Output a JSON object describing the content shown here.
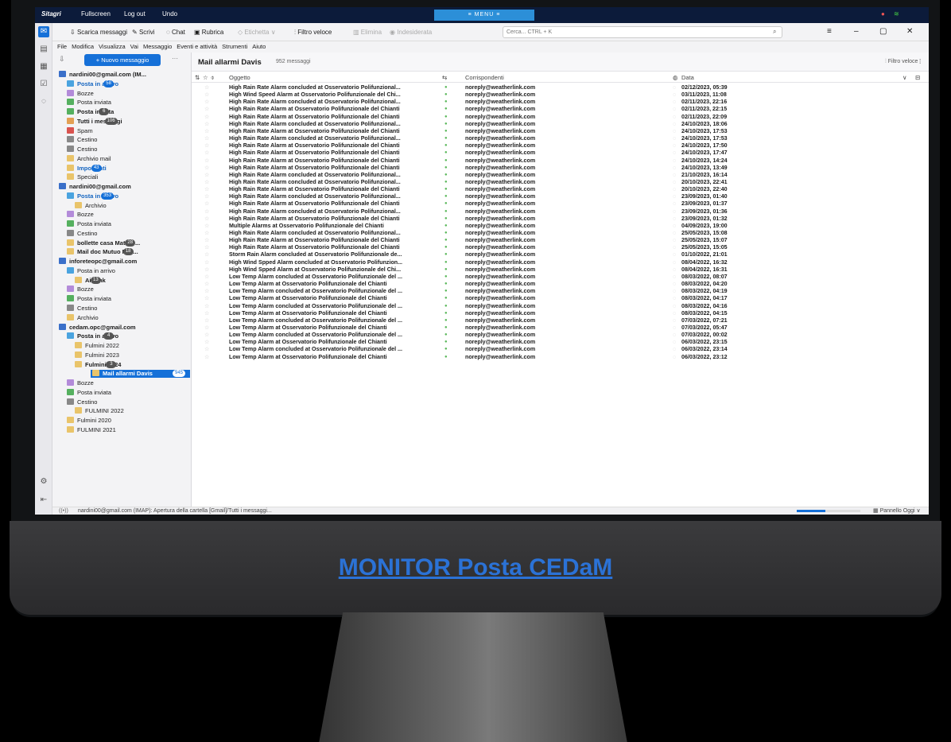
{
  "topbar": {
    "brand": "Sitagri",
    "fullscreen": "Fullscreen",
    "logout": "Log out",
    "undo": "Undo",
    "menu": "≡ MENU ≡"
  },
  "toolbar": {
    "get_messages": "Scarica messaggi",
    "write": "Scrivi",
    "chat": "Chat",
    "address_book": "Rubrica",
    "tag": "Etichetta",
    "quick_filter": "Filtro veloce",
    "delete": "Elimina",
    "junk": "Indesiderata",
    "search_placeholder": "Cerca... CTRL + K"
  },
  "menubar": [
    "File",
    "Modifica",
    "Visualizza",
    "Vai",
    "Messaggio",
    "Eventi e attività",
    "Strumenti",
    "Aiuto"
  ],
  "new_message": "+ Nuovo messaggio",
  "folders": [
    {
      "label": "nardini00@gmail.com (IM...",
      "bold": true,
      "account": true,
      "color": "#3a6fc9",
      "indent": 0
    },
    {
      "label": "Posta in arrivo",
      "bold": true,
      "badge": "58",
      "color": "#4aa3df",
      "indent": 1,
      "blue": true
    },
    {
      "label": "Bozze",
      "color": "#b38bd9",
      "indent": 1
    },
    {
      "label": "Posta inviata",
      "color": "#55b05f",
      "indent": 1
    },
    {
      "label": "Posta inviata",
      "bold": true,
      "badge": "6",
      "color": "#55b05f",
      "indent": 1
    },
    {
      "label": "Tutti i messaggi",
      "bold": true,
      "badge": "106",
      "color": "#e3a054",
      "indent": 1
    },
    {
      "label": "Spam",
      "color": "#d9534f",
      "indent": 1
    },
    {
      "label": "Cestino",
      "color": "#888",
      "indent": 1
    },
    {
      "label": "Cestino",
      "color": "#888",
      "indent": 1
    },
    {
      "label": "Archivio mail",
      "color": "#e9c46a",
      "indent": 1
    },
    {
      "label": "Importanti",
      "bold": true,
      "badge": "43",
      "color": "#e9c46a",
      "indent": 1,
      "blue": true
    },
    {
      "label": "Speciali",
      "color": "#e9c46a",
      "indent": 1
    },
    {
      "label": "nardini00@gmail.com",
      "bold": true,
      "account": true,
      "color": "#3a6fc9",
      "indent": 0
    },
    {
      "label": "Posta in arrivo",
      "bold": true,
      "badge": "353",
      "color": "#4aa3df",
      "indent": 1,
      "blue": true
    },
    {
      "label": "Archivio",
      "color": "#e9c46a",
      "indent": 2
    },
    {
      "label": "Bozze",
      "color": "#b38bd9",
      "indent": 1
    },
    {
      "label": "Posta inviata",
      "color": "#55b05f",
      "indent": 1
    },
    {
      "label": "Cestino",
      "color": "#888",
      "indent": 1
    },
    {
      "label": "bollette casa Matass...",
      "bold": true,
      "badge": "28",
      "color": "#e9c46a",
      "indent": 1
    },
    {
      "label": "Mail doc Mutuo Pite...",
      "bold": true,
      "badge": "18",
      "color": "#e9c46a",
      "indent": 1
    },
    {
      "label": "inforeteopc@gmail.com",
      "bold": true,
      "account": true,
      "color": "#3a6fc9",
      "indent": 0
    },
    {
      "label": "Posta in arrivo",
      "color": "#4aa3df",
      "indent": 1
    },
    {
      "label": "AirLink",
      "bold": true,
      "badge": "13",
      "color": "#e9c46a",
      "indent": 2
    },
    {
      "label": "Bozze",
      "color": "#b38bd9",
      "indent": 1
    },
    {
      "label": "Posta inviata",
      "color": "#55b05f",
      "indent": 1
    },
    {
      "label": "Cestino",
      "color": "#888",
      "indent": 1
    },
    {
      "label": "Archivio",
      "color": "#e9c46a",
      "indent": 1
    },
    {
      "label": "cedam.opc@gmail.com",
      "bold": true,
      "account": true,
      "color": "#3a6fc9",
      "indent": 0
    },
    {
      "label": "Posta in arrivo",
      "bold": true,
      "badge": "4",
      "color": "#4aa3df",
      "indent": 1
    },
    {
      "label": "Fulmini 2022",
      "color": "#e9c46a",
      "indent": 2
    },
    {
      "label": "Fulmini 2023",
      "color": "#e9c46a",
      "indent": 2
    },
    {
      "label": "Fulmini 2024",
      "bold": true,
      "badge": "3",
      "color": "#e9c46a",
      "indent": 2
    },
    {
      "label": "Mail allarmi Davis",
      "bold": true,
      "badge": "945",
      "color": "#e9c46a",
      "indent": 2,
      "selected": true
    },
    {
      "label": "Bozze",
      "color": "#b38bd9",
      "indent": 1
    },
    {
      "label": "Posta inviata",
      "color": "#55b05f",
      "indent": 1
    },
    {
      "label": "Cestino",
      "color": "#888",
      "indent": 1
    },
    {
      "label": "FULMINI 2022",
      "color": "#e9c46a",
      "indent": 2
    },
    {
      "label": "Fulmini 2020",
      "color": "#e9c46a",
      "indent": 1
    },
    {
      "label": "FULMINI 2021",
      "color": "#e9c46a",
      "indent": 1
    }
  ],
  "list": {
    "title": "Mail allarmi Davis",
    "count": "952 messaggi",
    "quick_filter": "Filtro veloce"
  },
  "columns": {
    "subject": "Oggetto",
    "correspondents": "Corrispondenti",
    "date": "Data"
  },
  "messages": [
    [
      "High Rain Rate Alarm concluded at Osservatorio Polifunzional...",
      "noreply@weatherlink.com",
      "02/12/2023, 05:39"
    ],
    [
      "High Wind Speed Alarm at Osservatorio Polifunzionale del Chi...",
      "noreply@weatherlink.com",
      "03/11/2023, 11:08"
    ],
    [
      "High Rain Rate Alarm concluded at Osservatorio Polifunzional...",
      "noreply@weatherlink.com",
      "02/11/2023, 22:16"
    ],
    [
      "High Rain Rate Alarm at Osservatorio Polifunzionale del Chianti",
      "noreply@weatherlink.com",
      "02/11/2023, 22:15"
    ],
    [
      "High Rain Rate Alarm at Osservatorio Polifunzionale del Chianti",
      "noreply@weatherlink.com",
      "02/11/2023, 22:09"
    ],
    [
      "High Rain Rate Alarm concluded at Osservatorio Polifunzional...",
      "noreply@weatherlink.com",
      "24/10/2023, 18:06"
    ],
    [
      "High Rain Rate Alarm at Osservatorio Polifunzionale del Chianti",
      "noreply@weatherlink.com",
      "24/10/2023, 17:53"
    ],
    [
      "High Rain Rate Alarm concluded at Osservatorio Polifunzional...",
      "noreply@weatherlink.com",
      "24/10/2023, 17:53"
    ],
    [
      "High Rain Rate Alarm at Osservatorio Polifunzionale del Chianti",
      "noreply@weatherlink.com",
      "24/10/2023, 17:50"
    ],
    [
      "High Rain Rate Alarm at Osservatorio Polifunzionale del Chianti",
      "noreply@weatherlink.com",
      "24/10/2023, 17:47"
    ],
    [
      "High Rain Rate Alarm at Osservatorio Polifunzionale del Chianti",
      "noreply@weatherlink.com",
      "24/10/2023, 14:24"
    ],
    [
      "High Rain Rate Alarm at Osservatorio Polifunzionale del Chianti",
      "noreply@weatherlink.com",
      "24/10/2023, 13:49"
    ],
    [
      "High Rain Rate Alarm concluded at Osservatorio Polifunzional...",
      "noreply@weatherlink.com",
      "21/10/2023, 16:14"
    ],
    [
      "High Rain Rate Alarm concluded at Osservatorio Polifunzional...",
      "noreply@weatherlink.com",
      "20/10/2023, 22:41"
    ],
    [
      "High Rain Rate Alarm at Osservatorio Polifunzionale del Chianti",
      "noreply@weatherlink.com",
      "20/10/2023, 22:40"
    ],
    [
      "High Rain Rate Alarm concluded at Osservatorio Polifunzional...",
      "noreply@weatherlink.com",
      "23/09/2023, 01:40"
    ],
    [
      "High Rain Rate Alarm at Osservatorio Polifunzionale del Chianti",
      "noreply@weatherlink.com",
      "23/09/2023, 01:37"
    ],
    [
      "High Rain Rate Alarm concluded at Osservatorio Polifunzional...",
      "noreply@weatherlink.com",
      "23/09/2023, 01:36"
    ],
    [
      "High Rain Rate Alarm at Osservatorio Polifunzionale del Chianti",
      "noreply@weatherlink.com",
      "23/09/2023, 01:32"
    ],
    [
      "Multiple Alarms at Osservatorio Polifunzionale del Chianti",
      "noreply@weatherlink.com",
      "04/09/2023, 19:00"
    ],
    [
      "High Rain Rate Alarm concluded at Osservatorio Polifunzional...",
      "noreply@weatherlink.com",
      "25/05/2023, 15:08"
    ],
    [
      "High Rain Rate Alarm at Osservatorio Polifunzionale del Chianti",
      "noreply@weatherlink.com",
      "25/05/2023, 15:07"
    ],
    [
      "High Rain Rate Alarm at Osservatorio Polifunzionale del Chianti",
      "noreply@weatherlink.com",
      "25/05/2023, 15:05"
    ],
    [
      "Storm Rain Alarm concluded at Osservatorio Polifunzionale de...",
      "noreply@weatherlink.com",
      "01/10/2022, 21:01"
    ],
    [
      "High Wind Spped Alarm concluded at Osservatorio Polifunzion...",
      "noreply@weatherlink.com",
      "08/04/2022, 16:32"
    ],
    [
      "High Wind Spped Alarm at Osservatorio Polifunzionale del Chi...",
      "noreply@weatherlink.com",
      "08/04/2022, 16:31"
    ],
    [
      "Low Temp Alarm concluded at Osservatorio Polifunzionale del ...",
      "noreply@weatherlink.com",
      "08/03/2022, 08:07"
    ],
    [
      "Low Temp Alarm at Osservatorio Polifunzionale del Chianti",
      "noreply@weatherlink.com",
      "08/03/2022, 04:20"
    ],
    [
      "Low Temp Alarm concluded at Osservatorio Polifunzionale del ...",
      "noreply@weatherlink.com",
      "08/03/2022, 04:19"
    ],
    [
      "Low Temp Alarm at Osservatorio Polifunzionale del Chianti",
      "noreply@weatherlink.com",
      "08/03/2022, 04:17"
    ],
    [
      "Low Temp Alarm concluded at Osservatorio Polifunzionale del ...",
      "noreply@weatherlink.com",
      "08/03/2022, 04:16"
    ],
    [
      "Low Temp Alarm at Osservatorio Polifunzionale del Chianti",
      "noreply@weatherlink.com",
      "08/03/2022, 04:15"
    ],
    [
      "Low Temp Alarm concluded at Osservatorio Polifunzionale del ...",
      "noreply@weatherlink.com",
      "07/03/2022, 07:21"
    ],
    [
      "Low Temp Alarm at Osservatorio Polifunzionale del Chianti",
      "noreply@weatherlink.com",
      "07/03/2022, 05:47"
    ],
    [
      "Low Temp Alarm concluded at Osservatorio Polifunzionale del ...",
      "noreply@weatherlink.com",
      "07/03/2022, 00:02"
    ],
    [
      "Low Temp Alarm at Osservatorio Polifunzionale del Chianti",
      "noreply@weatherlink.com",
      "06/03/2022, 23:15"
    ],
    [
      "Low Temp Alarm concluded at Osservatorio Polifunzionale del ...",
      "noreply@weatherlink.com",
      "06/03/2022, 23:14"
    ],
    [
      "Low Temp Alarm at Osservatorio Polifunzionale del Chianti",
      "noreply@weatherlink.com",
      "06/03/2022, 23:12"
    ]
  ],
  "status": {
    "text": "nardini00@gmail.com (IMAP): Apertura della cartella [Gmail]/Tutti i messaggi...",
    "today_pane": "Pannello Oggi",
    "progress": 0.45
  },
  "monitor_label": "MONITOR Posta CEDaM",
  "colors": {
    "accent": "#1570d8",
    "topbar": "#0c1b3a",
    "label": "#2b72d6"
  }
}
